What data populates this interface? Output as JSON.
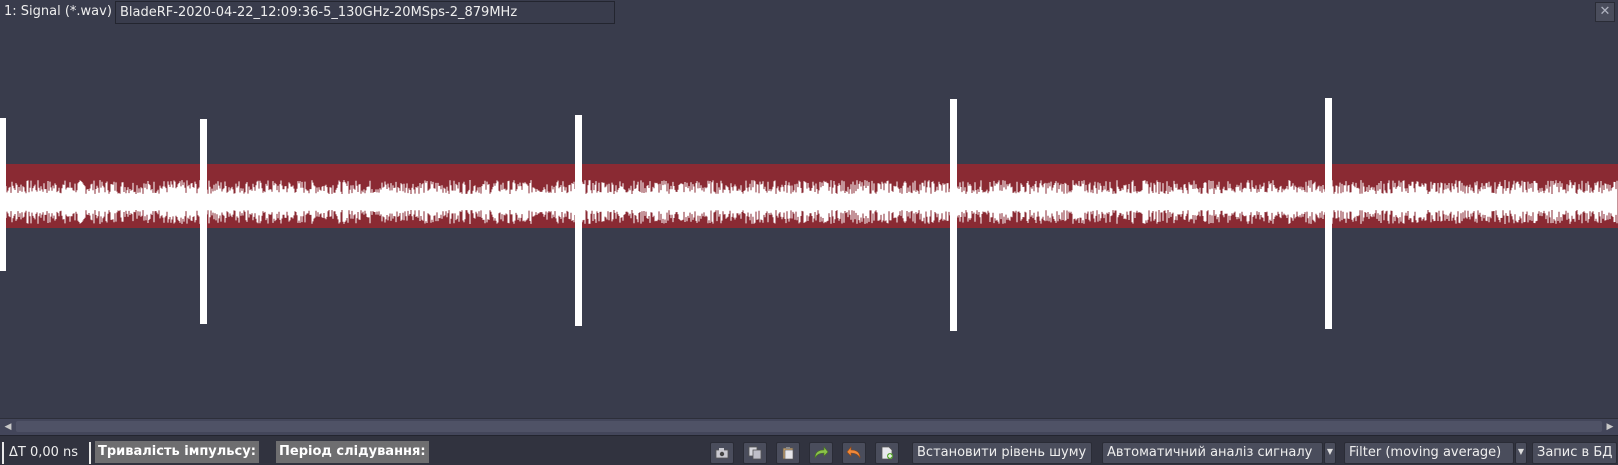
{
  "window": {
    "title": "1:  Signal (*.wav)",
    "filename": "BladeRF-2020-04-22_12:09:36-5_130GHz-20MSps-2_879MHz",
    "close_icon": "close-icon"
  },
  "signal": {
    "noise_band_color": "#8a2a33",
    "waveform_color": "#ffffff",
    "background_color": "#393c4c",
    "pulse_count": 5
  },
  "status": {
    "delta_t": "ΔT  0,00 ns",
    "pulse_duration_label": "Тривалість імпульсу:",
    "tracking_period_label": "Період слідування:"
  },
  "toolbar": {
    "icons": [
      "camera-icon",
      "copy-icon",
      "paste-icon",
      "redo-icon",
      "undo-icon",
      "new-document-icon"
    ],
    "set_noise_level": "Встановити рівень шуму",
    "auto_analysis": "Автоматичний аналіз сигналу",
    "filter": "Filter (moving average)",
    "save_db": "Запис в БД"
  }
}
